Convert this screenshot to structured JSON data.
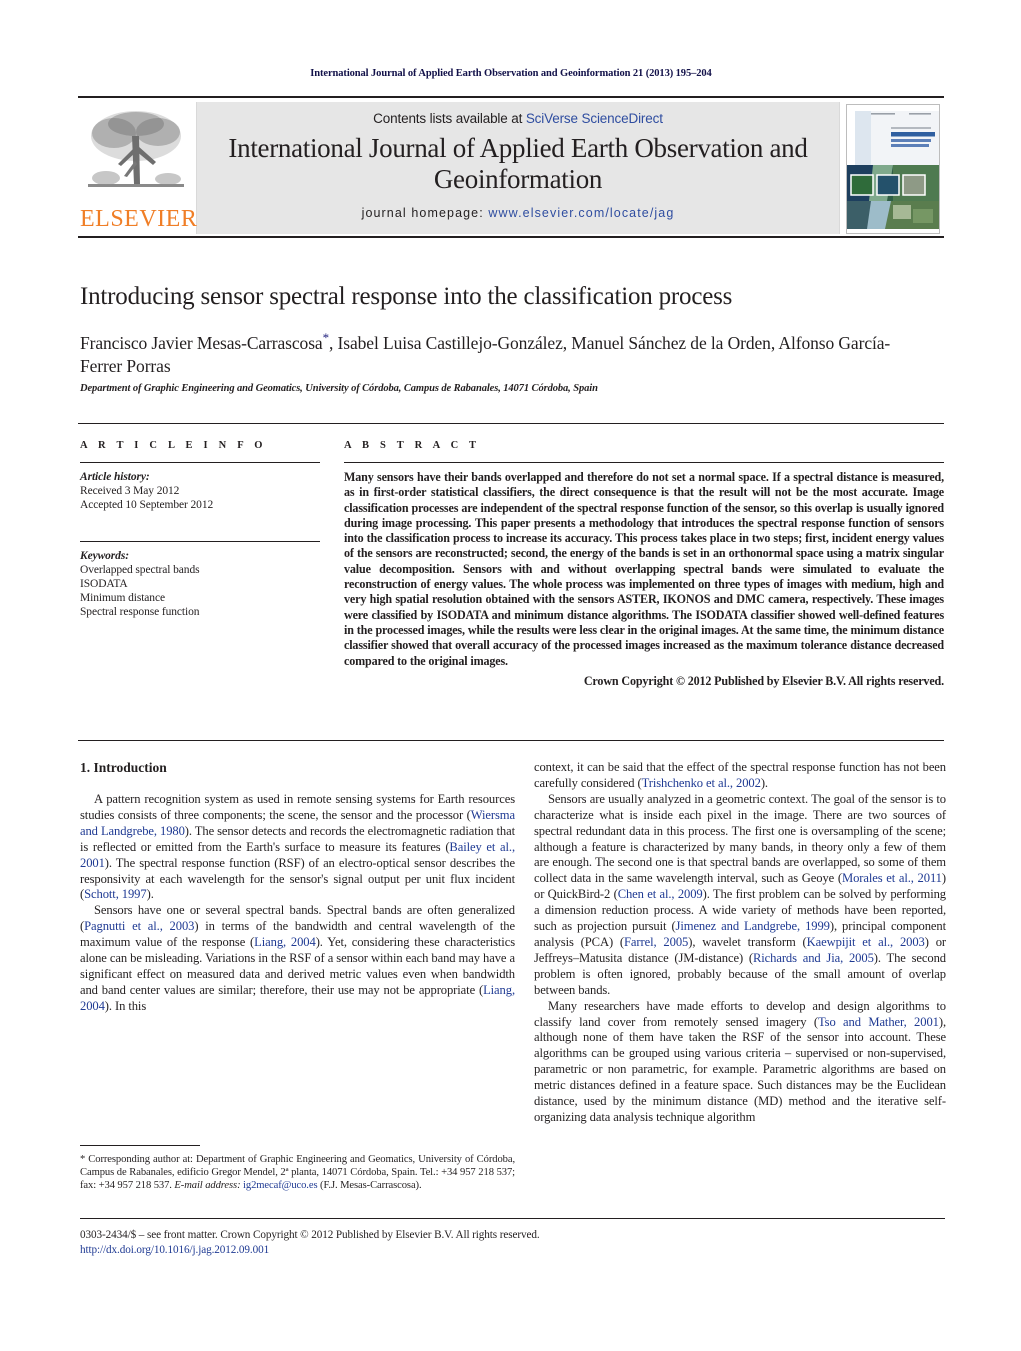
{
  "running_head": "International Journal of Applied Earth Observation and Geoinformation 21 (2013) 195–204",
  "masthead": {
    "publisher": "ELSEVIER",
    "contents_prefix": "Contents lists available at ",
    "contents_link": "SciVerse ScienceDirect",
    "journal_title": "International Journal of Applied Earth Observation and Geoinformation",
    "homepage_label": "journal homepage: ",
    "homepage_url": "www.elsevier.com/locate/jag",
    "cover_alt": "journal-cover-thumbnail"
  },
  "article": {
    "title": "Introducing sensor spectral response into the classification process",
    "authors_line1": "Francisco Javier Mesas-Carrascosa",
    "authors_star": "*",
    "authors_line1_rest": ", Isabel Luisa Castillejo-González, Manuel Sánchez de la Orden,",
    "authors_line2": "Alfonso García-Ferrer Porras",
    "affiliation": "Department of Graphic Engineering and Geomatics, University of Córdoba, Campus de Rabanales, 14071 Córdoba, Spain"
  },
  "article_info": {
    "heading": "A R T I C L E   I N F O",
    "history_label": "Article history:",
    "history": [
      "Received 3 May 2012",
      "Accepted 10 September 2012"
    ],
    "keywords_label": "Keywords:",
    "keywords": [
      "Overlapped spectral bands",
      "ISODATA",
      "Minimum distance",
      "Spectral response function"
    ]
  },
  "abstract": {
    "heading": "A B S T R A C T",
    "text": "Many sensors have their bands overlapped and therefore do not set a normal space. If a spectral distance is measured, as in first-order statistical classifiers, the direct consequence is that the result will not be the most accurate. Image classification processes are independent of the spectral response function of the sensor, so this overlap is usually ignored during image processing. This paper presents a methodology that introduces the spectral response function of sensors into the classification process to increase its accuracy. This process takes place in two steps; first, incident energy values of the sensors are reconstructed; second, the energy of the bands is set in an orthonormal space using a matrix singular value decomposition. Sensors with and without overlapping spectral bands were simulated to evaluate the reconstruction of energy values. The whole process was implemented on three types of images with medium, high and very high spatial resolution obtained with the sensors ASTER, IKONOS and DMC camera, respectively. These images were classified by ISODATA and minimum distance algorithms. The ISODATA classifier showed well-defined features in the processed images, while the results were less clear in the original images. At the same time, the minimum distance classifier showed that overall accuracy of the processed images increased as the maximum tolerance distance decreased compared to the original images.",
    "copyright": "Crown Copyright © 2012 Published by Elsevier B.V. All rights reserved."
  },
  "introduction": {
    "heading": "1.  Introduction",
    "left_paragraphs": [
      {
        "parts": [
          {
            "t": "A pattern recognition system as used in remote sensing systems for Earth resources studies consists of three components; the scene, the sensor and the processor (",
            "ref": false
          },
          {
            "t": "Wiersma and Landgrebe, 1980",
            "ref": true
          },
          {
            "t": "). The sensor detects and records the electromagnetic radiation that is reflected or emitted from the Earth's surface to measure its features (",
            "ref": false
          },
          {
            "t": "Bailey et al., 2001",
            "ref": true
          },
          {
            "t": "). The spectral response function (RSF) of an electro-optical sensor describes the responsivity at each wavelength for the sensor's signal output per unit flux incident (",
            "ref": false
          },
          {
            "t": "Schott, 1997",
            "ref": true
          },
          {
            "t": ").",
            "ref": false
          }
        ]
      },
      {
        "parts": [
          {
            "t": "Sensors have one or several spectral bands. Spectral bands are often generalized (",
            "ref": false
          },
          {
            "t": "Pagnutti et al., 2003",
            "ref": true
          },
          {
            "t": ") in terms of the bandwidth and central wavelength of the maximum value of the response (",
            "ref": false
          },
          {
            "t": "Liang, 2004",
            "ref": true
          },
          {
            "t": "). Yet, considering these characteristics alone can be misleading. Variations in the RSF of a sensor within each band may have a significant effect on measured data and derived metric values even when bandwidth and band center values are similar; therefore, their use may not be appropriate (",
            "ref": false
          },
          {
            "t": "Liang, 2004",
            "ref": true
          },
          {
            "t": "). In this",
            "ref": false
          }
        ]
      }
    ],
    "right_paragraphs": [
      {
        "continuation": true,
        "parts": [
          {
            "t": "context, it can be said that the effect of the spectral response function has not been carefully considered (",
            "ref": false
          },
          {
            "t": "Trishchenko et al., 2002",
            "ref": true
          },
          {
            "t": ").",
            "ref": false
          }
        ]
      },
      {
        "parts": [
          {
            "t": "Sensors are usually analyzed in a geometric context. The goal of the sensor is to characterize what is inside each pixel in the image. There are two sources of spectral redundant data in this process. The first one is oversampling of the scene; although a feature is characterized by many bands, in theory only a few of them are enough. The second one is that spectral bands are overlapped, so some of them collect data in the same wavelength interval, such as Geoye (",
            "ref": false
          },
          {
            "t": "Morales et al., 2011",
            "ref": true
          },
          {
            "t": ") or QuickBird-2 (",
            "ref": false
          },
          {
            "t": "Chen et al., 2009",
            "ref": true
          },
          {
            "t": "). The first problem can be solved by performing a dimension reduction process. A wide variety of methods have been reported, such as projection pursuit (",
            "ref": false
          },
          {
            "t": "Jimenez and Landgrebe, 1999",
            "ref": true
          },
          {
            "t": "), principal component analysis (PCA) (",
            "ref": false
          },
          {
            "t": "Farrel, 2005",
            "ref": true
          },
          {
            "t": "), wavelet transform (",
            "ref": false
          },
          {
            "t": "Kaewpijit et al., 2003",
            "ref": true
          },
          {
            "t": ") or Jeffreys–Matusita distance (JM-distance) (",
            "ref": false
          },
          {
            "t": "Richards and Jia, 2005",
            "ref": true
          },
          {
            "t": "). The second problem is often ignored, probably because of the small amount of overlap between bands.",
            "ref": false
          }
        ]
      },
      {
        "parts": [
          {
            "t": "Many researchers have made efforts to develop and design algorithms to classify land cover from remotely sensed imagery (",
            "ref": false
          },
          {
            "t": "Tso and Mather, 2001",
            "ref": true
          },
          {
            "t": "), although none of them have taken the RSF of the sensor into account. These algorithms can be grouped using various criteria – supervised or non-supervised, parametric or non parametric, for example. Parametric algorithms are based on metric distances defined in a feature space. Such distances may be the Euclidean distance, used by the minimum distance (MD) method and the iterative self-organizing data analysis technique algorithm",
            "ref": false
          }
        ]
      }
    ]
  },
  "footnote": {
    "star": "*",
    "text": " Corresponding author at: Department of Graphic Engineering and Geomatics, University of Córdoba, Campus de Rabanales, edificio Gregor Mendel, 2ª planta, 14071 Córdoba, Spain. Tel.: +34 957 218 537; fax: +34 957 218 537.",
    "email_label": "E-mail address:",
    "email": " ig2mecaf@uco.es",
    "email_owner": " (F.J. Mesas-Carrascosa)."
  },
  "footer": {
    "issn_line": "0303-2434/$ – see front matter. Crown Copyright © 2012 Published by Elsevier B.V. All rights reserved.",
    "doi": "http://dx.doi.org/10.1016/j.jag.2012.09.001"
  },
  "colors": {
    "link": "#1f3a93",
    "elsevier_orange": "#f07e26",
    "band_grey": "#e6e6e6",
    "text": "#231f20"
  }
}
